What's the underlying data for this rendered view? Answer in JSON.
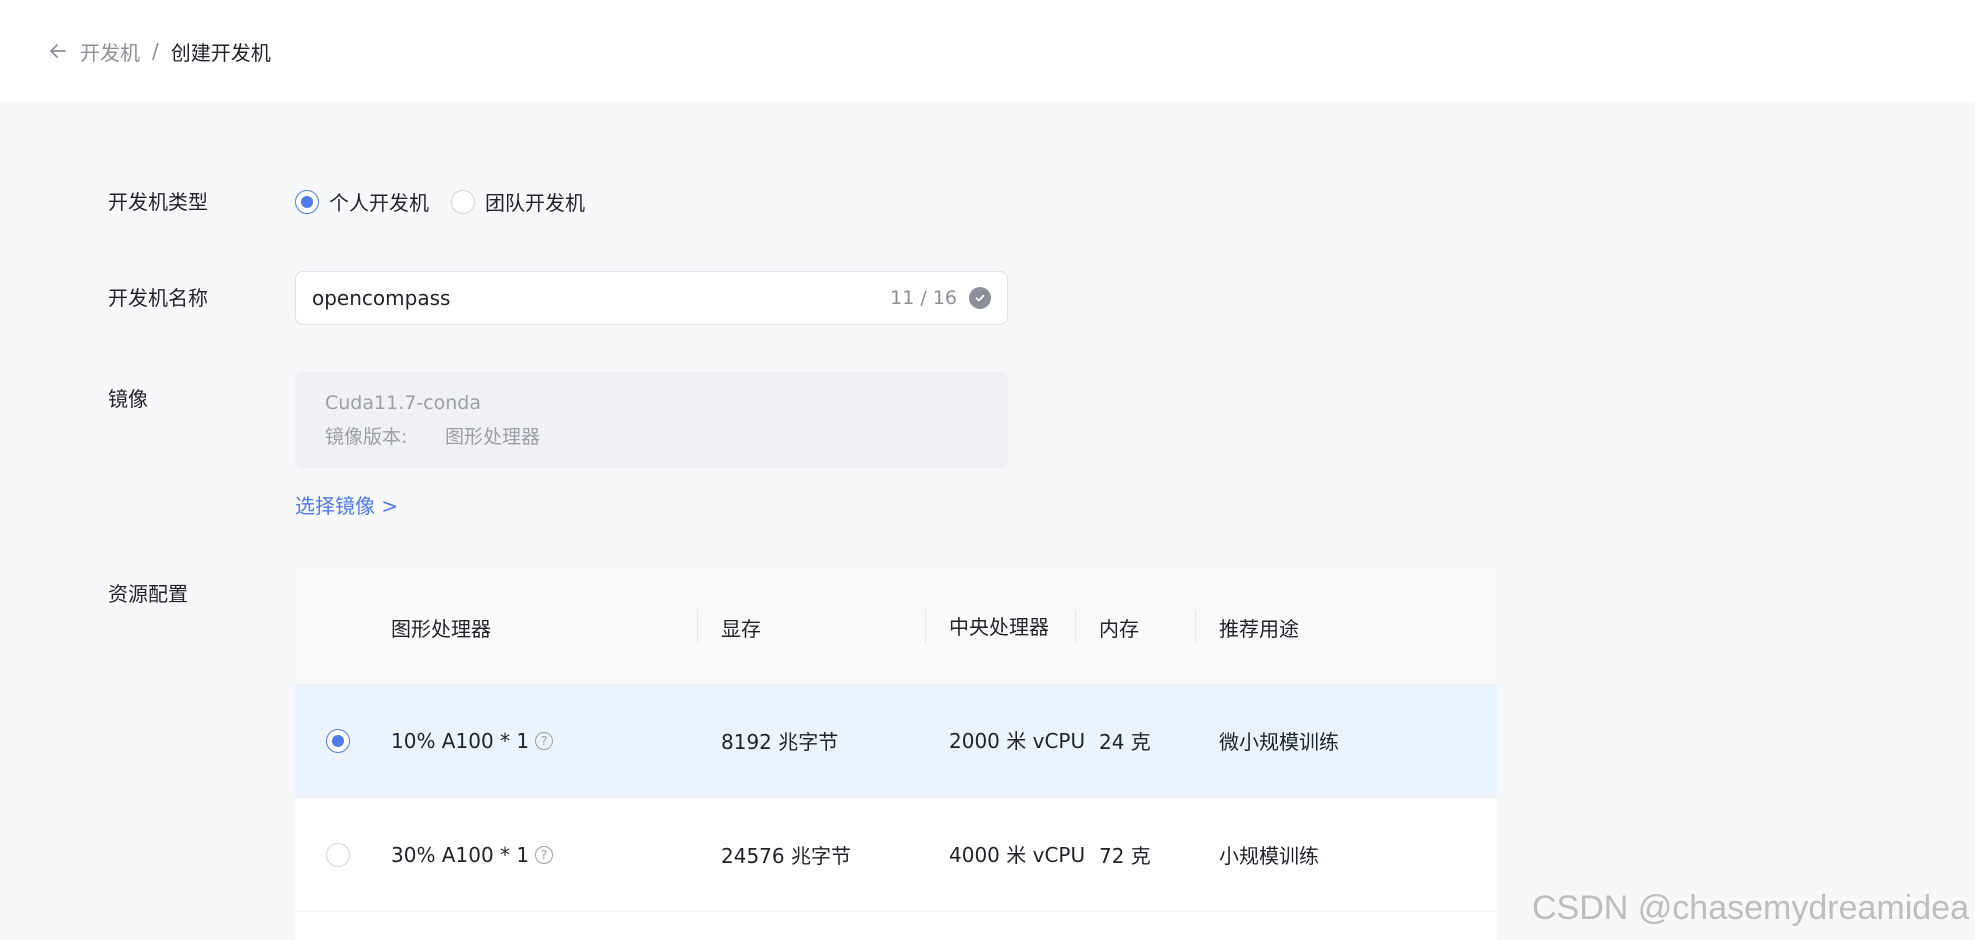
{
  "breadcrumb": {
    "parent": "开发机",
    "separator": "/",
    "current": "创建开发机"
  },
  "form": {
    "type_label": "开发机类型",
    "type_options": [
      {
        "label": "个人开发机",
        "selected": true
      },
      {
        "label": "团队开发机",
        "selected": false
      }
    ],
    "name_label": "开发机名称",
    "name_value": "opencompass",
    "name_count": "11 / 16",
    "image_label": "镜像",
    "image_name": "Cuda11.7-conda",
    "image_version_key": "镜像版本:",
    "image_version_value": "图形处理器",
    "select_image": "选择镜像 >",
    "resource_label": "资源配置"
  },
  "table": {
    "headers": [
      "图形处理器",
      "显存",
      "中央处理器",
      "内存",
      "推荐用途"
    ],
    "rows": [
      {
        "gpu": "10% A100 * 1",
        "vram": "8192 兆字节",
        "cpu": "2000 米 vCPU",
        "mem": "24 克",
        "use": "微小规模训练",
        "selected": true
      },
      {
        "gpu": "30% A100 * 1",
        "vram": "24576 兆字节",
        "cpu": "4000 米 vCPU",
        "mem": "72 克",
        "use": "小规模训练",
        "selected": false
      }
    ]
  },
  "watermark": "CSDN @chasemydreamidea",
  "colors": {
    "accent": "#4e7bea",
    "selected_row": "#ebf3fd"
  }
}
